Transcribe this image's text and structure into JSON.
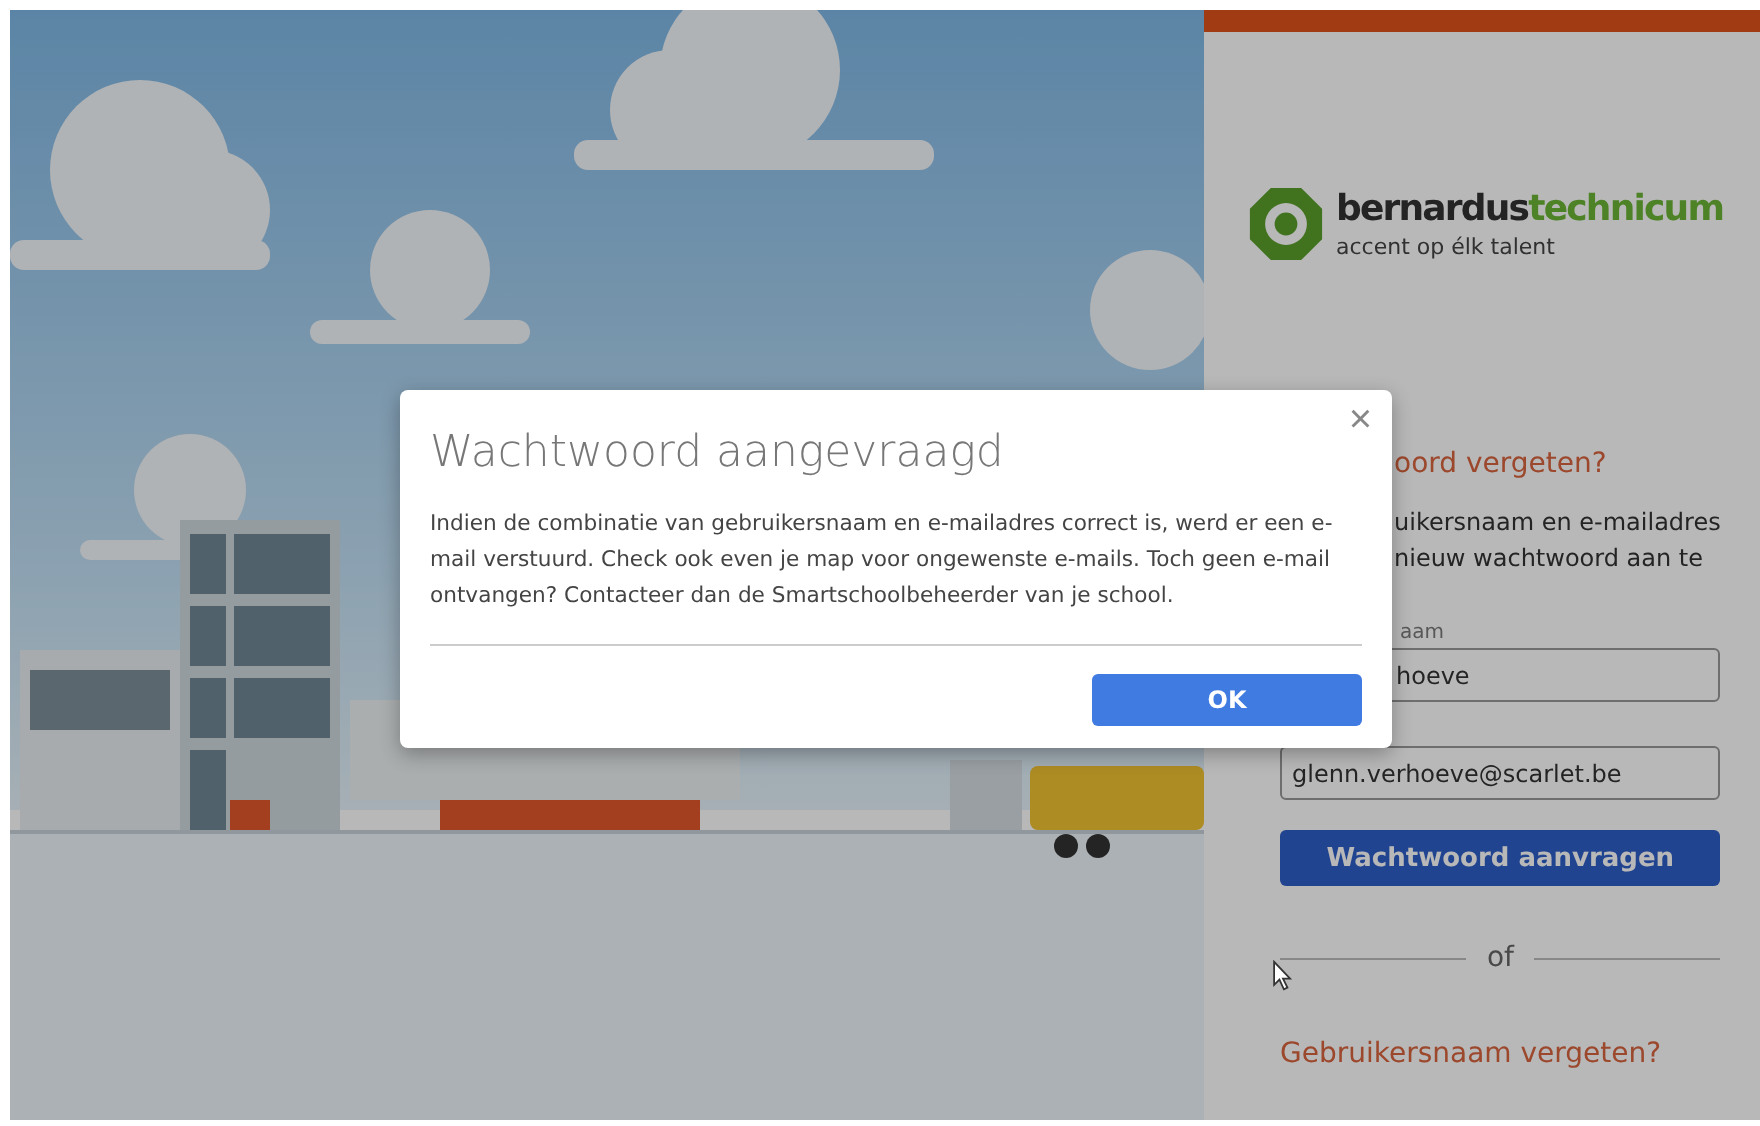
{
  "login_panel": {
    "logo": {
      "name_part_1": "bernardus",
      "name_part_2": "technicum",
      "tagline": "accent op élk talent"
    },
    "password_section": {
      "heading": "oord vergeten?",
      "text_lines": [
        "uikersnaam en e-mailadres",
        "nieuw wachtwoord aan te"
      ],
      "username_label": "aam",
      "username_value": "hoeve",
      "email_value": "glenn.verhoeve@scarlet.be",
      "submit_button": "Wachtwoord aanvragen"
    },
    "separator": "of",
    "username_section": {
      "heading": "Gebruikersnaam vergeten?"
    }
  },
  "dialog": {
    "title": "Wachtwoord aangevraagd",
    "close": "×",
    "message": "Indien de combinatie van gebruikersnaam en e-mailadres correct is, werd er een e-mail verstuurd. Check ook even je map voor ongewenste e-mails. Toch geen e-mail ontvangen? Contacteer dan de Smartschoolbeheerder van je school.",
    "buttons": [
      "OK"
    ]
  }
}
